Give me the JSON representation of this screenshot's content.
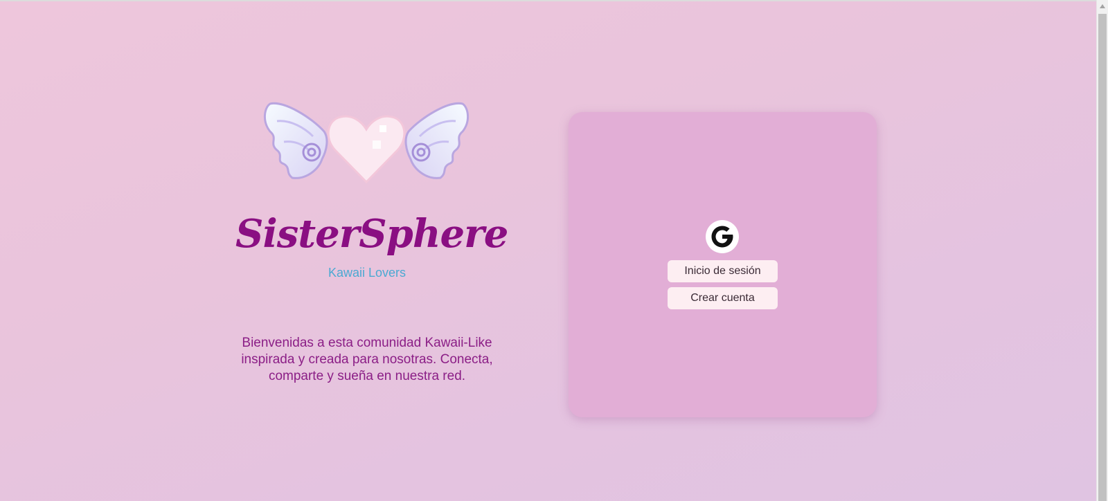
{
  "brand": {
    "title": "SisterSphere",
    "subtitle": "Kawaii Lovers",
    "logo_icon": "winged-heart-icon"
  },
  "welcome_text": "Bienvenidas a esta comunidad Kawaii-Like inspirada y creada para nosotras. Conecta, comparte y sueña en nuestra red.",
  "auth": {
    "google_icon": "google-icon",
    "login_label": "Inicio de sesión",
    "register_label": "Crear cuenta"
  },
  "colors": {
    "title": "#8a0f82",
    "subtitle": "#4aa9d2",
    "welcome": "#8b1e86",
    "card": "#e2aed6",
    "button": "#fdeef2"
  }
}
